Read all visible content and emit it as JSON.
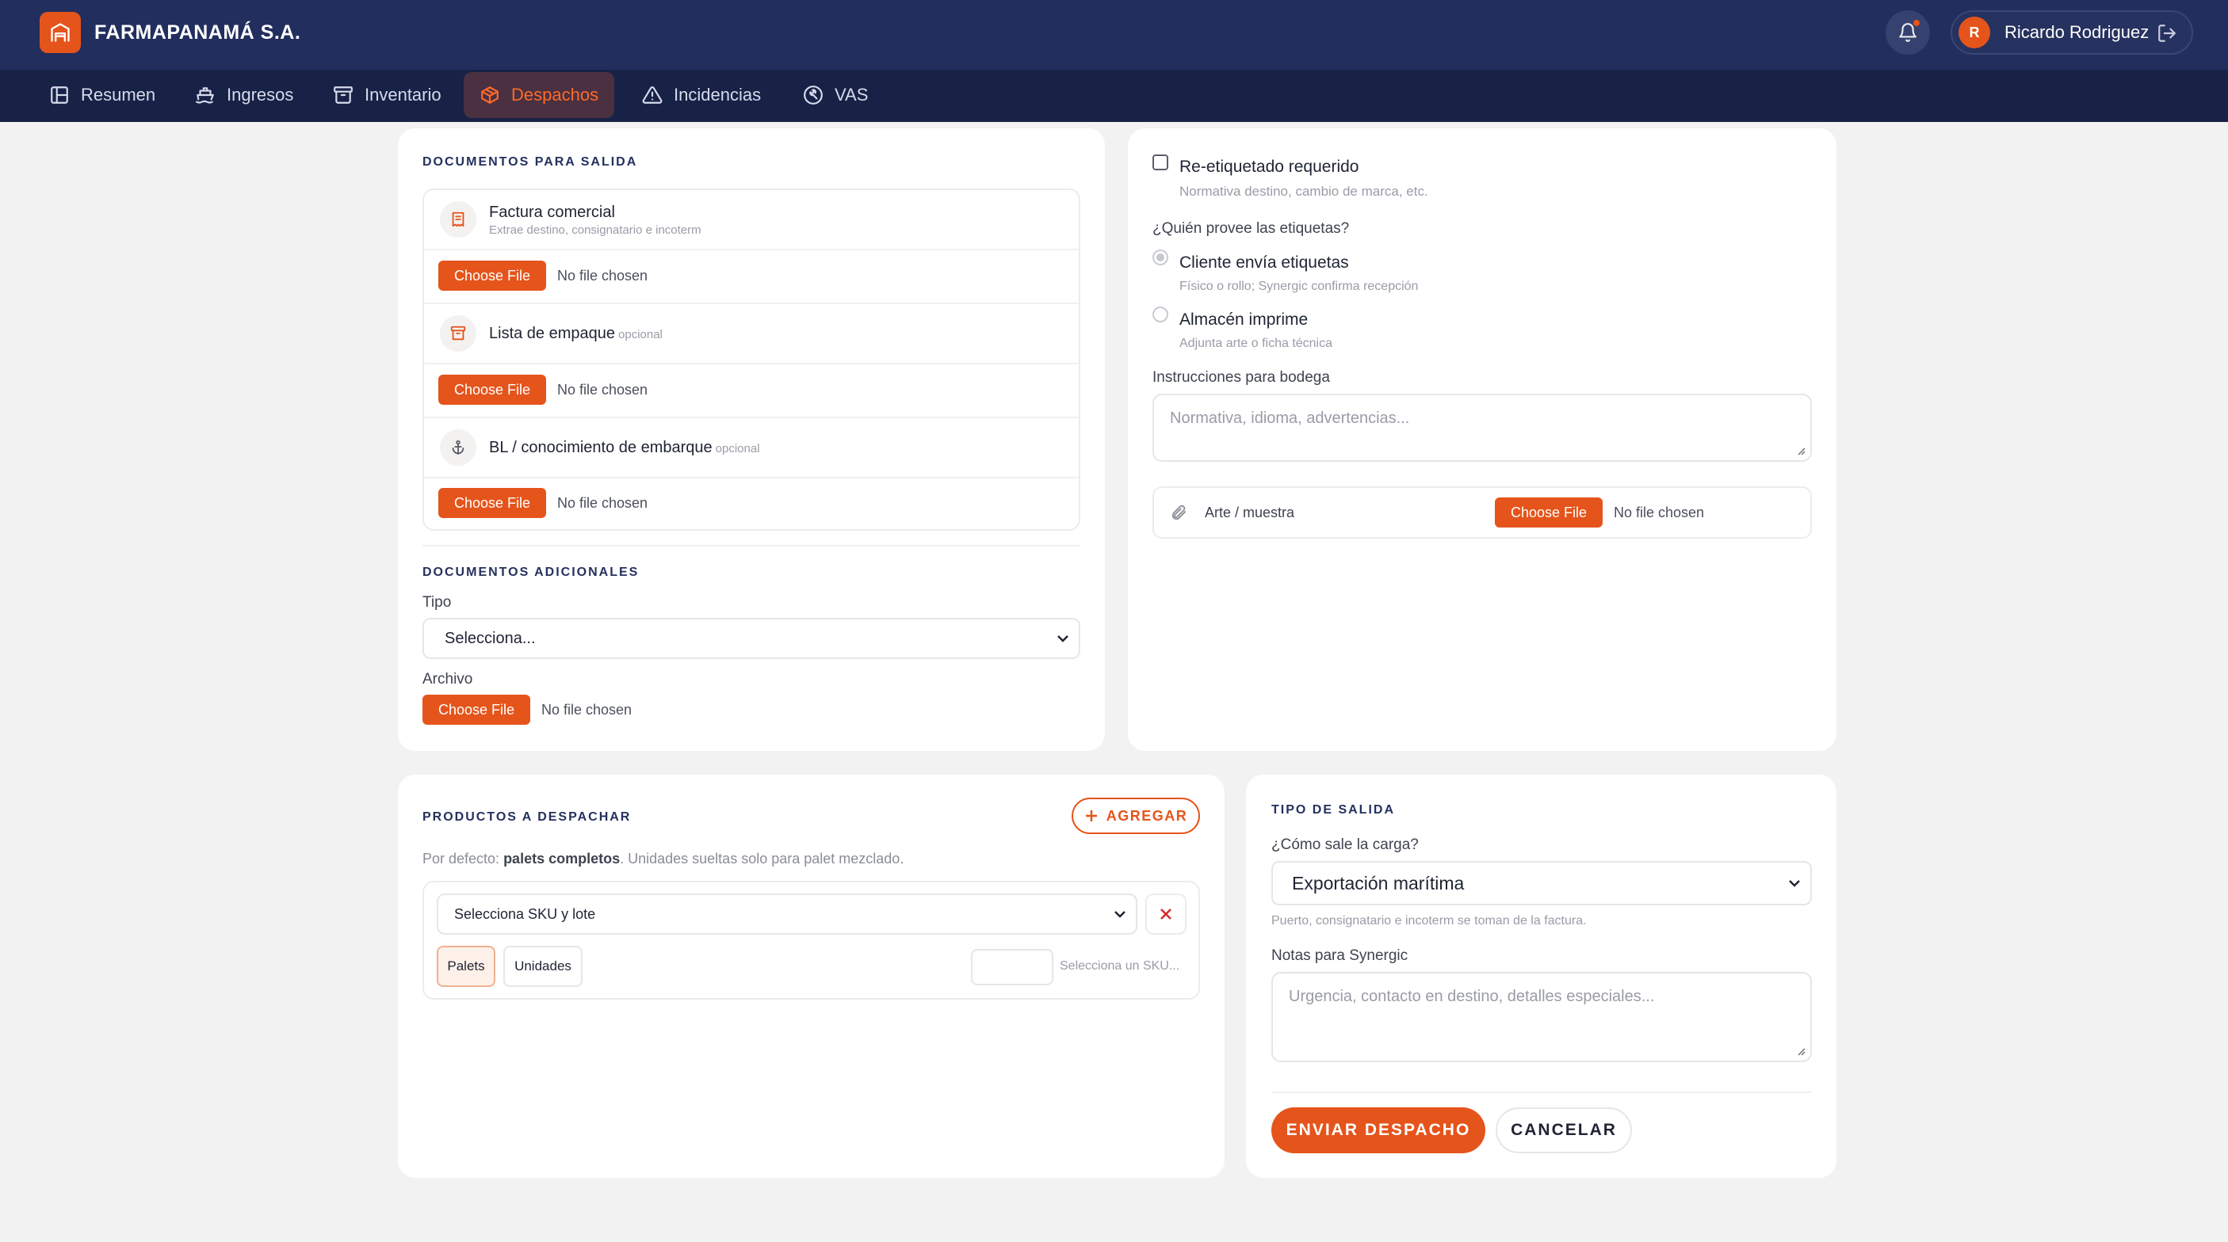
{
  "header": {
    "company": "FARMAPANAMÁ S.A.",
    "user_initial": "R",
    "user_name": "Ricardo Rodriguez"
  },
  "nav": {
    "items": [
      {
        "label": "Resumen",
        "icon": "layout-icon"
      },
      {
        "label": "Ingresos",
        "icon": "ship-icon"
      },
      {
        "label": "Inventario",
        "icon": "archive-icon"
      },
      {
        "label": "Despachos",
        "icon": "box-icon",
        "active": true
      },
      {
        "label": "Incidencias",
        "icon": "warning-icon"
      },
      {
        "label": "VAS",
        "icon": "wrench-icon"
      }
    ]
  },
  "documents": {
    "title": "DOCUMENTOS PARA SALIDA",
    "items": [
      {
        "title": "Factura comercial",
        "subtitle": "Extrae destino, consignatario e incoterm",
        "optional": "",
        "icon": "receipt-icon"
      },
      {
        "title": "Lista de empaque",
        "subtitle": "",
        "optional": "opcional",
        "icon": "package-list-icon"
      },
      {
        "title": "BL / conocimiento de embarque",
        "subtitle": "",
        "optional": "opcional",
        "icon": "anchor-icon"
      }
    ],
    "choose_file": "Choose File",
    "no_file": "No file chosen",
    "additional_title": "DOCUMENTOS ADICIONALES",
    "tipo_label": "Tipo",
    "tipo_value": "Selecciona...",
    "archivo_label": "Archivo"
  },
  "labeling": {
    "relabel_label": "Re-etiquetado requerido",
    "relabel_hint": "Normativa destino, cambio de marca, etc.",
    "relabel_checked": false,
    "question": "¿Quién provee las etiquetas?",
    "options": [
      {
        "label": "Cliente envía etiquetas",
        "hint": "Físico o rollo; Synergic confirma recepción",
        "checked": true
      },
      {
        "label": "Almacén imprime",
        "hint": "Adjunta arte o ficha técnica",
        "checked": false
      }
    ],
    "instructions_label": "Instrucciones para bodega",
    "instructions_placeholder": "Normativa, idioma, advertencias...",
    "art_label": "Arte / muestra"
  },
  "products": {
    "title": "PRODUCTOS A DESPACHAR",
    "add_label": "AGREGAR",
    "hint_prefix": "Por defecto: ",
    "hint_bold": "palets completos",
    "hint_suffix": ". Unidades sueltas solo para palet mezclado.",
    "sku_placeholder": "Selecciona SKU y lote",
    "unit_palets": "Palets",
    "unit_unidades": "Unidades",
    "qty_value": "",
    "qty_hint": "Selecciona un SKU..."
  },
  "exit": {
    "title": "TIPO DE SALIDA",
    "question": "¿Cómo sale la carga?",
    "value": "Exportación marítima",
    "hint": "Puerto, consignatario e incoterm se toman de la factura.",
    "notes_label": "Notas para Synergic",
    "notes_placeholder": "Urgencia, contacto en destino, detalles especiales...",
    "submit": "ENVIAR DESPACHO",
    "cancel": "CANCELAR"
  },
  "colors": {
    "navy": "#222e5e",
    "nav_dark": "#182247",
    "accent": "#e5541b"
  }
}
